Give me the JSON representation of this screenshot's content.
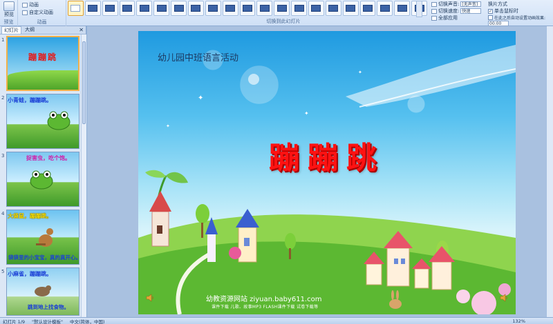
{
  "ribbon": {
    "preview_label": "预览",
    "preview_group": "预览",
    "anim_rows": [
      "动画",
      "自定义动画"
    ],
    "anim_group": "动画",
    "transition_group": "切换到此幻灯片",
    "sound_label": "切换声音:",
    "sound_value": "[无声音]",
    "speed_label": "切换速度:",
    "speed_value": "快速",
    "apply_all": "全部应用",
    "advance_label": "换片方式",
    "on_click": "单击鼠标时",
    "after_label": "在此之后自动设置动画效果:",
    "after_value": "00:00"
  },
  "panel": {
    "tabs": [
      "幻灯片",
      "大纲"
    ],
    "slides": [
      {
        "num": "1",
        "top_text": "",
        "title": "蹦蹦跳",
        "bottom_text": "",
        "selected": true
      },
      {
        "num": "2",
        "top_text": "小青蛙，蹦蹦跳。",
        "title": "",
        "bottom_text": ""
      },
      {
        "num": "3",
        "top_text": "捉害虫，吃个饱。",
        "title": "",
        "bottom_text": ""
      },
      {
        "num": "4",
        "top_text": "大袋鼠，蹦蹦跳。",
        "title": "",
        "bottom_text": "袋袋里的小宝宝，真的真开心。"
      },
      {
        "num": "5",
        "top_text": "小麻雀，蹦蹦跳。",
        "title": "",
        "bottom_text": "跳到地上找食物。"
      }
    ]
  },
  "slide": {
    "subtitle": "幼儿园中班语言活动",
    "title": "蹦蹦跳",
    "footer": "幼教资源网站  ziyuan.baby611.com",
    "footer_sub": "课件下载  儿歌、故事MP3  FLASH课件下载  试卷下载等"
  },
  "status": {
    "slide_info": "幻灯片 1/9",
    "theme": "\"默认设计模板\"",
    "language": "中文(简体，中国)",
    "zoom": "132%"
  },
  "colors": {
    "title_red": "#ff1212",
    "sky_blue": "#55c0ef",
    "grass_green": "#5cb832"
  }
}
